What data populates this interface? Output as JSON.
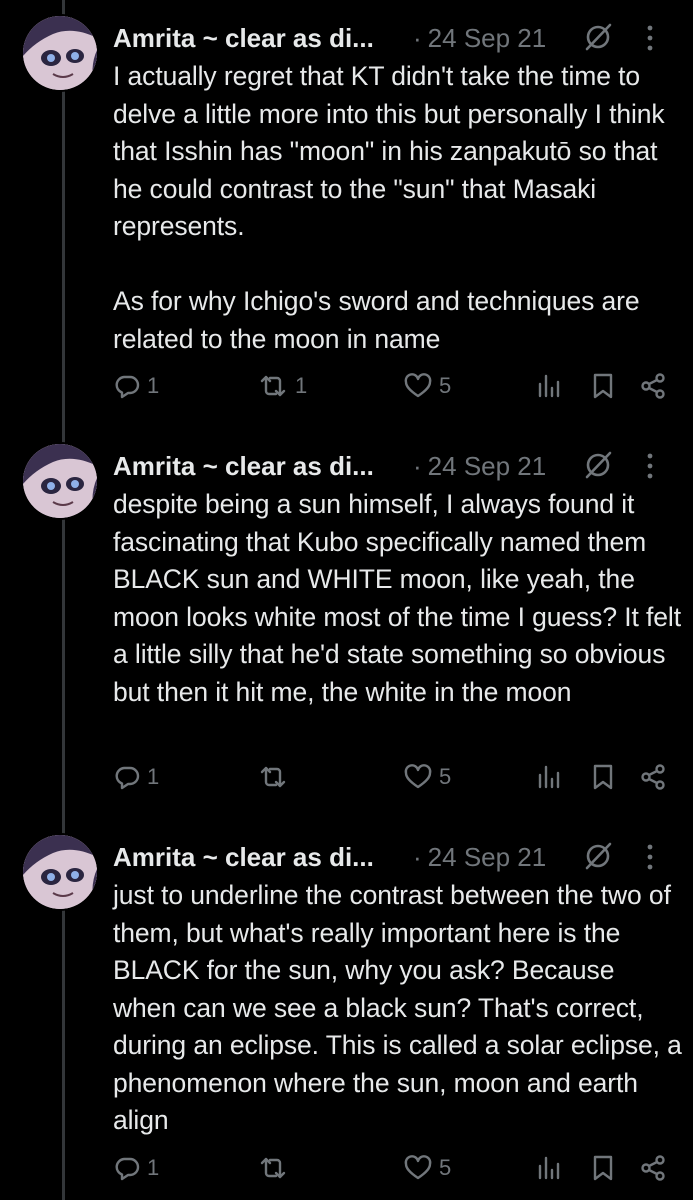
{
  "posts": [
    {
      "author": "Amrita ~ clear as di...",
      "dot": "·",
      "date": "24 Sep 21",
      "text": "I actually regret that KT didn't take the time to delve a little more into this but personally I think that Isshin has \"moon\" in his zanpakutō so that he could contrast to the \"sun\" that Masaki represents.\n\nAs for why Ichigo's sword and techniques are related to the moon in name",
      "replies": "1",
      "reposts": "1",
      "likes": "5"
    },
    {
      "author": "Amrita ~ clear as di...",
      "dot": "·",
      "date": "24 Sep 21",
      "text": "despite being a sun himself, I always found it fascinating that Kubo specifically named them BLACK sun and WHITE moon, like yeah, the moon looks white most of the time I guess? It felt a little silly that he'd state something so obvious but then it hit me, the white in the moon",
      "replies": "1",
      "reposts": "",
      "likes": "5"
    },
    {
      "author": "Amrita ~ clear as di...",
      "dot": "·",
      "date": "24 Sep 21",
      "text": "just to underline the contrast between the two of them, but what's really important here is the BLACK for the sun, why you ask? Because when can we see a black sun? That's correct, during an eclipse. This is called a solar eclipse, a phenomenon where the sun, moon and earth align",
      "replies": "1",
      "reposts": "",
      "likes": "5"
    }
  ],
  "icons": {
    "reply": "reply-icon",
    "repost": "repost-icon",
    "like": "heart-icon",
    "views": "views-icon",
    "bookmark": "bookmark-icon",
    "share": "share-icon",
    "grok": "grok-icon",
    "more": "more-icon"
  },
  "colors": {
    "background": "#000000",
    "text": "#e7e9ea",
    "muted": "#71767b",
    "thread_line": "#333639"
  }
}
